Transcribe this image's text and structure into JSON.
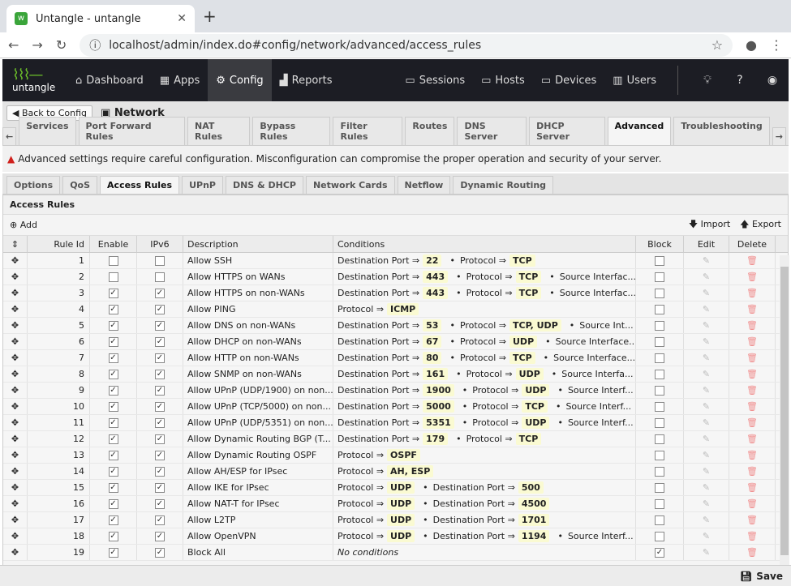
{
  "browser": {
    "tab_title": "Untangle - untangle",
    "url": "localhost/admin/index.do#config/network/advanced/access_rules"
  },
  "nav": {
    "logo": "untangle",
    "items": [
      "Dashboard",
      "Apps",
      "Config",
      "Reports"
    ],
    "right_items": [
      "Sessions",
      "Hosts",
      "Devices",
      "Users"
    ]
  },
  "header": {
    "back_label": "Back to Config",
    "title": "Network"
  },
  "tabs": [
    "Services",
    "Port Forward Rules",
    "NAT Rules",
    "Bypass Rules",
    "Filter Rules",
    "Routes",
    "DNS Server",
    "DHCP Server",
    "Advanced",
    "Troubleshooting"
  ],
  "warning": "Advanced settings require careful configuration. Misconfiguration can compromise the proper operation and security of your server.",
  "subtabs": [
    "Options",
    "QoS",
    "Access Rules",
    "UPnP",
    "DNS & DHCP",
    "Network Cards",
    "Netflow",
    "Dynamic Routing"
  ],
  "panel": {
    "title": "Access Rules",
    "add": "Add",
    "import": "Import",
    "export": "Export",
    "save": "Save"
  },
  "columns": [
    "Rule Id",
    "Enable",
    "IPv6",
    "Description",
    "Conditions",
    "Block",
    "Edit",
    "Delete"
  ],
  "rows": [
    {
      "id": "1",
      "enable": false,
      "ipv6": false,
      "desc": "Allow SSH",
      "cond": [
        [
          "Destination Port ⇒",
          "22"
        ],
        [
          "Protocol ⇒",
          "TCP"
        ]
      ],
      "more": "",
      "block": false
    },
    {
      "id": "2",
      "enable": false,
      "ipv6": false,
      "desc": "Allow HTTPS on WANs",
      "cond": [
        [
          "Destination Port ⇒",
          "443"
        ],
        [
          "Protocol ⇒",
          "TCP"
        ]
      ],
      "more": "Source Interfac...",
      "block": false
    },
    {
      "id": "3",
      "enable": true,
      "ipv6": true,
      "desc": "Allow HTTPS on non-WANs",
      "cond": [
        [
          "Destination Port ⇒",
          "443"
        ],
        [
          "Protocol ⇒",
          "TCP"
        ]
      ],
      "more": "Source Interfac...",
      "block": false
    },
    {
      "id": "4",
      "enable": true,
      "ipv6": true,
      "desc": "Allow PING",
      "cond": [
        [
          "Protocol ⇒",
          "ICMP"
        ]
      ],
      "more": "",
      "block": false
    },
    {
      "id": "5",
      "enable": true,
      "ipv6": true,
      "desc": "Allow DNS on non-WANs",
      "cond": [
        [
          "Destination Port ⇒",
          "53"
        ],
        [
          "Protocol ⇒",
          "TCP, UDP"
        ]
      ],
      "more": "Source Int...",
      "block": false
    },
    {
      "id": "6",
      "enable": true,
      "ipv6": true,
      "desc": "Allow DHCP on non-WANs",
      "cond": [
        [
          "Destination Port ⇒",
          "67"
        ],
        [
          "Protocol ⇒",
          "UDP"
        ]
      ],
      "more": "Source Interface...",
      "block": false
    },
    {
      "id": "7",
      "enable": true,
      "ipv6": true,
      "desc": "Allow HTTP on non-WANs",
      "cond": [
        [
          "Destination Port ⇒",
          "80"
        ],
        [
          "Protocol ⇒",
          "TCP"
        ]
      ],
      "more": "Source Interface...",
      "block": false
    },
    {
      "id": "8",
      "enable": true,
      "ipv6": true,
      "desc": "Allow SNMP on non-WANs",
      "cond": [
        [
          "Destination Port ⇒",
          "161"
        ],
        [
          "Protocol ⇒",
          "UDP"
        ]
      ],
      "more": "Source Interfa...",
      "block": false
    },
    {
      "id": "9",
      "enable": true,
      "ipv6": true,
      "desc": "Allow UPnP (UDP/1900) on non...",
      "cond": [
        [
          "Destination Port ⇒",
          "1900"
        ],
        [
          "Protocol ⇒",
          "UDP"
        ]
      ],
      "more": "Source Interf...",
      "block": false
    },
    {
      "id": "10",
      "enable": true,
      "ipv6": true,
      "desc": "Allow UPnP (TCP/5000) on non...",
      "cond": [
        [
          "Destination Port ⇒",
          "5000"
        ],
        [
          "Protocol ⇒",
          "TCP"
        ]
      ],
      "more": "Source Interf...",
      "block": false
    },
    {
      "id": "11",
      "enable": true,
      "ipv6": true,
      "desc": "Allow UPnP (UDP/5351) on non...",
      "cond": [
        [
          "Destination Port ⇒",
          "5351"
        ],
        [
          "Protocol ⇒",
          "UDP"
        ]
      ],
      "more": "Source Interf...",
      "block": false
    },
    {
      "id": "12",
      "enable": true,
      "ipv6": true,
      "desc": "Allow Dynamic Routing BGP (T...",
      "cond": [
        [
          "Destination Port ⇒",
          "179"
        ],
        [
          "Protocol ⇒",
          "TCP"
        ]
      ],
      "more": "",
      "block": false
    },
    {
      "id": "13",
      "enable": true,
      "ipv6": true,
      "desc": "Allow Dynamic Routing OSPF",
      "cond": [
        [
          "Protocol ⇒",
          "OSPF"
        ]
      ],
      "more": "",
      "block": false
    },
    {
      "id": "14",
      "enable": true,
      "ipv6": true,
      "desc": "Allow AH/ESP for IPsec",
      "cond": [
        [
          "Protocol ⇒",
          "AH, ESP"
        ]
      ],
      "more": "",
      "block": false
    },
    {
      "id": "15",
      "enable": true,
      "ipv6": true,
      "desc": "Allow IKE for IPsec",
      "cond": [
        [
          "Protocol ⇒",
          "UDP"
        ],
        [
          "Destination Port ⇒",
          "500"
        ]
      ],
      "more": "",
      "block": false
    },
    {
      "id": "16",
      "enable": true,
      "ipv6": true,
      "desc": "Allow NAT-T for IPsec",
      "cond": [
        [
          "Protocol ⇒",
          "UDP"
        ],
        [
          "Destination Port ⇒",
          "4500"
        ]
      ],
      "more": "",
      "block": false
    },
    {
      "id": "17",
      "enable": true,
      "ipv6": true,
      "desc": "Allow L2TP",
      "cond": [
        [
          "Protocol ⇒",
          "UDP"
        ],
        [
          "Destination Port ⇒",
          "1701"
        ]
      ],
      "more": "",
      "block": false
    },
    {
      "id": "18",
      "enable": true,
      "ipv6": true,
      "desc": "Allow OpenVPN",
      "cond": [
        [
          "Protocol ⇒",
          "UDP"
        ],
        [
          "Destination Port ⇒",
          "1194"
        ]
      ],
      "more": "Source Interf...",
      "block": false
    },
    {
      "id": "19",
      "enable": true,
      "ipv6": true,
      "desc": "Block All",
      "cond": [],
      "more": "",
      "none": "No conditions",
      "block": true
    }
  ]
}
